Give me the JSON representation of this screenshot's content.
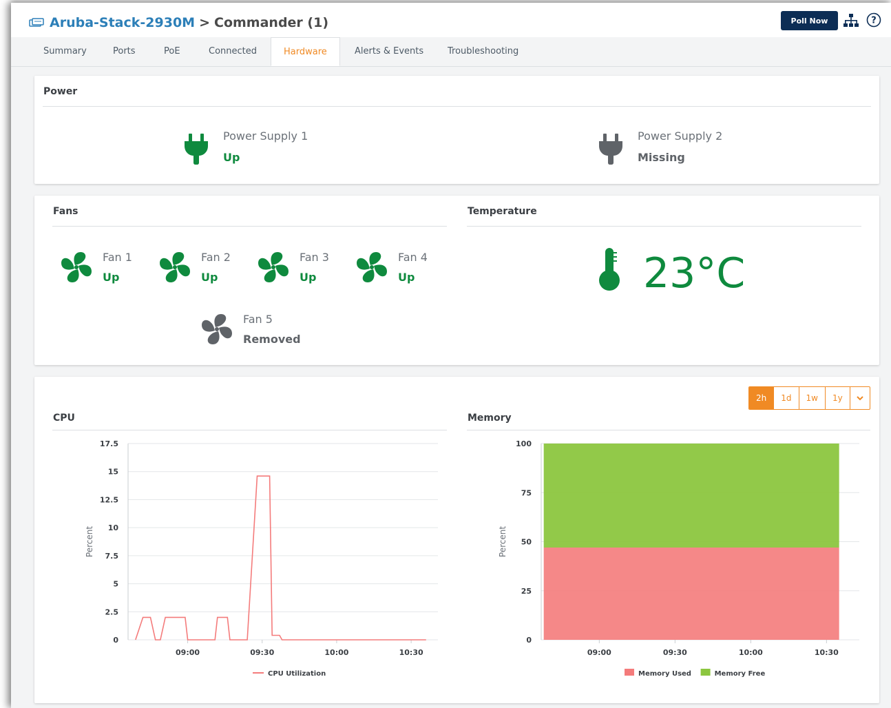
{
  "header": {
    "device_name": "Aruba-Stack-2930M",
    "separator": ">",
    "member": "Commander (1)",
    "poll_now_label": "Poll Now"
  },
  "tabs": [
    {
      "label": "Summary",
      "active": false
    },
    {
      "label": "Ports",
      "active": false
    },
    {
      "label": "PoE",
      "active": false
    },
    {
      "label": "Connected",
      "active": false
    },
    {
      "label": "Hardware",
      "active": true
    },
    {
      "label": "Alerts & Events",
      "active": false
    },
    {
      "label": "Troubleshooting",
      "active": false
    }
  ],
  "power": {
    "title": "Power",
    "supplies": [
      {
        "name": "Power Supply 1",
        "status": "Up",
        "icon": "plug-icon",
        "color": "#0f8a3e"
      },
      {
        "name": "Power Supply 2",
        "status": "Missing",
        "icon": "plug-icon",
        "color": "#5f6368"
      }
    ]
  },
  "fans": {
    "title": "Fans",
    "items": [
      {
        "name": "Fan 1",
        "status": "Up",
        "color": "#0f8a3e"
      },
      {
        "name": "Fan 2",
        "status": "Up",
        "color": "#0f8a3e"
      },
      {
        "name": "Fan 3",
        "status": "Up",
        "color": "#0f8a3e"
      },
      {
        "name": "Fan 4",
        "status": "Up",
        "color": "#0f8a3e"
      },
      {
        "name": "Fan 5",
        "status": "Removed",
        "color": "#5f6368"
      }
    ]
  },
  "temperature": {
    "title": "Temperature",
    "value": "23°C",
    "icon": "thermometer-icon",
    "color": "#0f8a3e"
  },
  "time_range": {
    "options": [
      "2h",
      "1d",
      "1w",
      "1y"
    ],
    "selected": "2h",
    "dropdown_icon": "chevron-down-icon"
  },
  "chart_data": [
    {
      "type": "line",
      "title": "CPU",
      "ylabel": "Percent",
      "ylim": [
        0,
        17.5
      ],
      "yticks": [
        "0",
        "2.5",
        "5",
        "7.5",
        "10",
        "12.5",
        "15",
        "17.5"
      ],
      "xticks": [
        "09:00",
        "09:30",
        "10:00",
        "10:30"
      ],
      "x": [
        "08:39",
        "08:42",
        "08:45",
        "08:47",
        "08:49",
        "08:51",
        "08:53",
        "08:55",
        "08:57",
        "08:59",
        "09:00",
        "09:04",
        "09:09",
        "09:11",
        "09:12",
        "09:16",
        "09:17",
        "09:19",
        "09:22",
        "09:24",
        "09:28",
        "09:29",
        "09:33",
        "09:34",
        "09:37",
        "09:38",
        "09:40",
        "10:00",
        "10:30",
        "10:36"
      ],
      "series": [
        {
          "name": "CPU Utilization",
          "color": "#f47b7b",
          "values": [
            0,
            2,
            2,
            0,
            0,
            2,
            2,
            2,
            2,
            2,
            0,
            0,
            0,
            0,
            2,
            2,
            0,
            0,
            0,
            0,
            14.6,
            14.6,
            14.6,
            0.4,
            0.4,
            0,
            0,
            0,
            0,
            0
          ]
        }
      ],
      "legend": "bottom"
    },
    {
      "type": "area",
      "title": "Memory",
      "ylabel": "Percent",
      "ylim": [
        0,
        100
      ],
      "yticks": [
        "0",
        "25",
        "50",
        "75",
        "100"
      ],
      "xticks": [
        "09:00",
        "09:30",
        "10:00",
        "10:30"
      ],
      "x": [
        "08:38",
        "10:35"
      ],
      "stacked": true,
      "series": [
        {
          "name": "Memory Used",
          "color": "#f47b7b",
          "values": [
            47,
            47
          ]
        },
        {
          "name": "Memory Free",
          "color": "#8cc63f",
          "values": [
            53,
            53
          ]
        }
      ],
      "legend": "bottom"
    }
  ]
}
